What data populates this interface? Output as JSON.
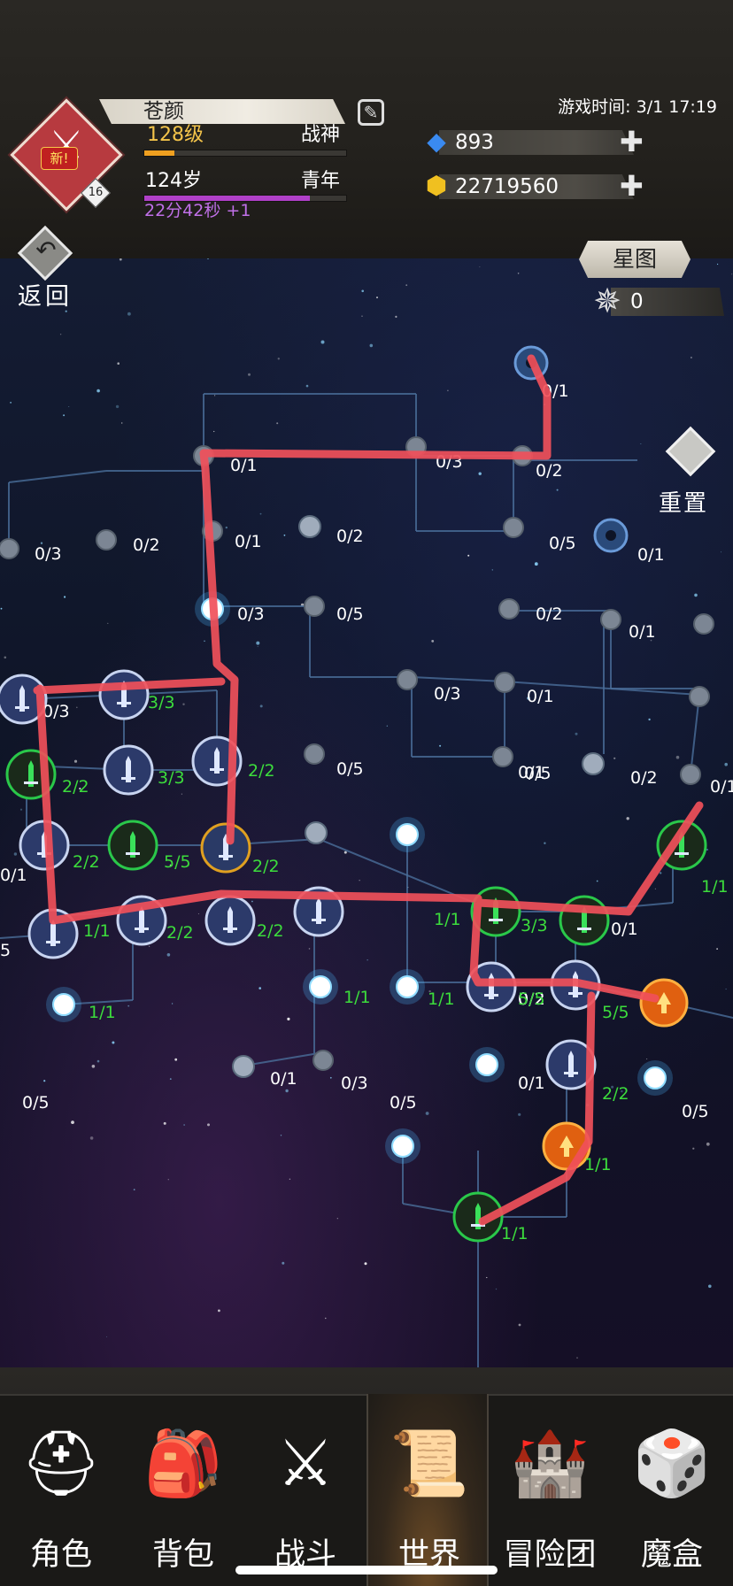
{
  "player": {
    "name": "苍颜",
    "level": "128级",
    "title": "战神",
    "level_progress": 0.15,
    "age": "124岁",
    "age_stage": "青年",
    "age_timer": "22分42秒 +1",
    "age_progress": 0.82,
    "new_badge": "新!",
    "badge_level": "16"
  },
  "header": {
    "game_time": "游戏时间: 3/1 17:19",
    "gems": "893",
    "gold": "22719560",
    "back_label": "返回"
  },
  "starmap": {
    "star_chart_label": "星图",
    "star_count": "0",
    "reset_label": "重置",
    "node_counts": [
      "0/1",
      "0/1",
      "0/2",
      "0/3",
      "0/1",
      "0/2",
      "0/3",
      "0/2",
      "0/5",
      "0/1",
      "0/3",
      "0/5",
      "0/2",
      "0/1",
      "0/3",
      "0/1",
      "0/5",
      "0/5",
      "0/1",
      "0/2",
      "0/1",
      "0/3",
      "3/3",
      "2/2",
      "2/2",
      "3/3",
      "2/2",
      "5/5",
      "2/2",
      "1/1",
      "2/2",
      "2/2",
      "1/1",
      "3/3",
      "0/1",
      "1/1",
      "1/1",
      "1/1",
      "0/2",
      "0/2",
      "5/5",
      "5/5",
      "1/1",
      "0/1",
      "0/3",
      "0/1",
      "2/2",
      "0/5",
      "0/5",
      "1/1",
      "1/1",
      "0/5",
      "0/1",
      "5",
      "0/1"
    ]
  },
  "nav": {
    "items": [
      {
        "label": "角色",
        "icon": "helmet-icon"
      },
      {
        "label": "背包",
        "icon": "backpack-icon"
      },
      {
        "label": "战斗",
        "icon": "sword-shield-icon"
      },
      {
        "label": "世界",
        "icon": "scroll-icon"
      },
      {
        "label": "冒险团",
        "icon": "castle-icon"
      },
      {
        "label": "魔盒",
        "icon": "magic-box-icon"
      }
    ],
    "selected": "世界"
  },
  "colors": {
    "annotation_line": "#f0505a",
    "active_count": "#3cdc3c",
    "inactive_count": "#ffffff",
    "level_bar": "#f0a020",
    "age_bar": "#b040c8",
    "age_timer_text": "#c070e8"
  }
}
